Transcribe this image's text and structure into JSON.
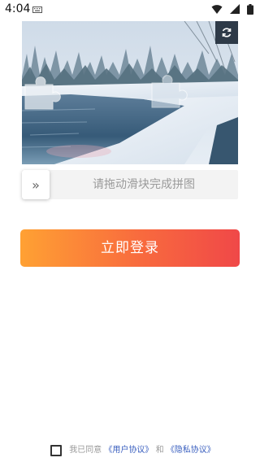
{
  "status_bar": {
    "time": "4:04",
    "icons": [
      "keyboard-icon",
      "wifi-icon",
      "signal-icon",
      "battery-icon"
    ]
  },
  "captcha": {
    "image_desc_icon": "snowy-lake-landscape",
    "refresh_icon": "refresh-icon"
  },
  "slider": {
    "handle_icon": "double-chevron-right-icon",
    "handle_text": "»",
    "hint": "请拖动滑块完成拼图"
  },
  "login": {
    "label": "立即登录"
  },
  "agreement": {
    "prefix": "我已同意",
    "user_agreement": "《用户协议》",
    "and": "和",
    "privacy_agreement": "《隐私协议》"
  },
  "colors": {
    "button_start": "#ffa133",
    "button_end": "#f04848",
    "link": "#3a5fbf"
  }
}
